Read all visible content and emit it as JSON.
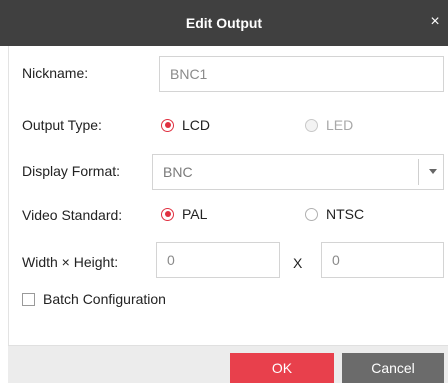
{
  "dialog": {
    "title": "Edit Output",
    "close_glyph": "×"
  },
  "form": {
    "nickname": {
      "label": "Nickname:",
      "value": "BNC1"
    },
    "output_type": {
      "label": "Output Type:",
      "options": [
        {
          "label": "LCD",
          "selected": true,
          "enabled": true
        },
        {
          "label": "LED",
          "selected": false,
          "enabled": false
        }
      ]
    },
    "display_format": {
      "label": "Display Format:",
      "value": "BNC"
    },
    "video_standard": {
      "label": "Video Standard:",
      "options": [
        {
          "label": "PAL",
          "selected": true
        },
        {
          "label": "NTSC",
          "selected": false
        }
      ]
    },
    "size": {
      "label": "Width × Height:",
      "width": "0",
      "separator": "X",
      "height": "0"
    },
    "batch_configuration": {
      "label": "Batch Configuration",
      "checked": false
    }
  },
  "footer": {
    "ok_label": "OK",
    "cancel_label": "Cancel"
  },
  "colors": {
    "title_bar": "#404040",
    "accent": "#e8404c",
    "cancel": "#6b6b6b"
  }
}
